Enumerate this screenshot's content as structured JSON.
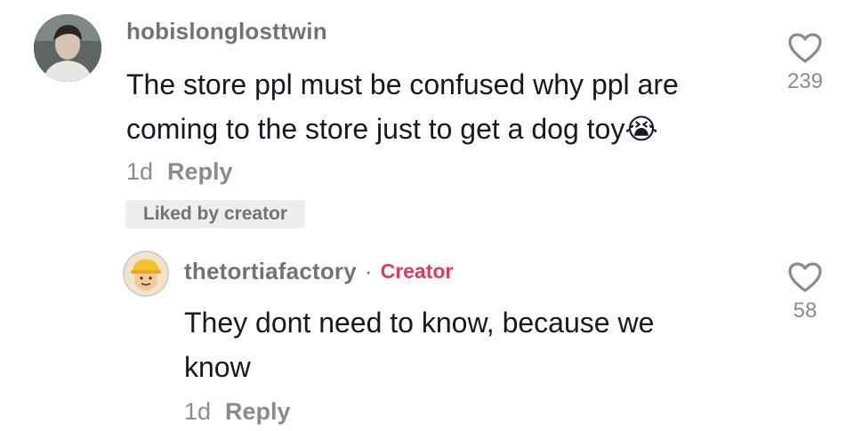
{
  "comment": {
    "username": "hobislonglosttwin",
    "text_line1": "The store ppl must be confused why ppl are",
    "text_line2": "coming to the store just to get a dog toy",
    "emoji": "😭",
    "age": "1d",
    "reply_label": "Reply",
    "liked_badge": "Liked by creator",
    "like_count": "239"
  },
  "reply": {
    "username": "thetortiafactory",
    "separator": "·",
    "creator_label": "Creator",
    "text_line1": "They dont need to know, because we",
    "text_line2": "know",
    "age": "1d",
    "reply_label": "Reply",
    "like_count": "58"
  },
  "colors": {
    "text": "#161823",
    "muted": "#8a8b91",
    "creator_accent": "#e03a5a"
  },
  "icons": [
    "heart-outline-icon",
    "avatar-photo",
    "hardhat-avatar"
  ]
}
